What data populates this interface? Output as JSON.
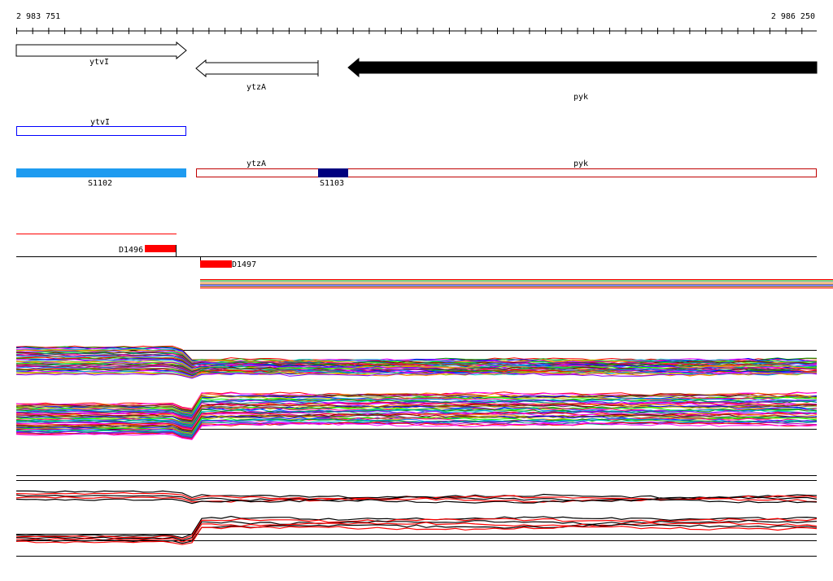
{
  "ruler": {
    "start_label": "2 983 751",
    "end_label": "2 986 250"
  },
  "genes": {
    "ytvI": "ytvI",
    "ytzA": "ytzA",
    "pyk": "pyk"
  },
  "track_labels": {
    "ytvI_box": "ytvI",
    "ytzA_box": "ytzA",
    "pyk_box": "pyk"
  },
  "segments": {
    "s1102": "S1102",
    "s1103": "S1103"
  },
  "features": {
    "d1496": "D1496",
    "d1497": "D1497"
  },
  "colors": {
    "s1102": "#1e9bf0",
    "s1103": "#00007f",
    "downregion": "#ff0000",
    "box_blue": "#0000ff",
    "box_red": "#c00000"
  }
}
